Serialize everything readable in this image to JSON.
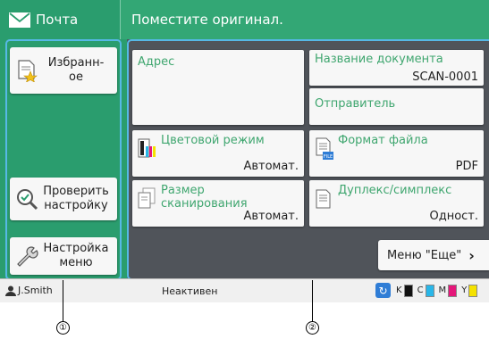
{
  "app": {
    "title": "Почта",
    "icon": "envelope-icon"
  },
  "header": {
    "message": "Поместите оригинал."
  },
  "sidebar": {
    "favorites_label": "Избранн-\nое",
    "check_label": "Проверить\nнастройку",
    "menu_label": "Настройка\nменю"
  },
  "tiles": {
    "address": {
      "label": "Адрес"
    },
    "docname": {
      "label": "Название документа",
      "value": "SCAN-0001"
    },
    "sender": {
      "label": "Отправитель"
    },
    "color_mode": {
      "label": "Цветовой режим",
      "value": "Автомат."
    },
    "file_format": {
      "label": "Формат файла",
      "value": "PDF",
      "badge": "FILE"
    },
    "scan_size": {
      "label": "Размер\nсканирования",
      "value": "Автомат."
    },
    "duplex": {
      "label": "Дуплекс/симплекс",
      "value": "Одност."
    }
  },
  "more_button": {
    "label": "Меню \"Еще\"",
    "icon": "chevron-right-icon"
  },
  "status": {
    "user": "J.Smith",
    "state": "Неактивен",
    "inks": [
      {
        "letter": "K",
        "color": "#111111"
      },
      {
        "letter": "C",
        "color": "#29b6e8"
      },
      {
        "letter": "M",
        "color": "#e4187a"
      },
      {
        "letter": "Y",
        "color": "#f5e200"
      }
    ]
  },
  "callouts": [
    "①",
    "②"
  ],
  "colors": {
    "accent": "#2a9d6e",
    "header": "#33a775",
    "label_green": "#3fa66f",
    "bracket": "#56b8e6"
  }
}
